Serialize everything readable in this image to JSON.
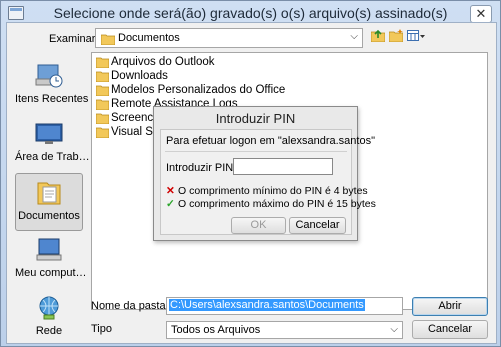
{
  "title": "Selecione onde será(ão) gravado(s) o(s) arquivo(s) assinado(s)",
  "look_in": {
    "label": "Examinar",
    "value": "Documentos"
  },
  "places": [
    {
      "label": "Itens Recentes"
    },
    {
      "label": "Área de Trab…"
    },
    {
      "label": "Documentos"
    },
    {
      "label": "Meu comput…"
    },
    {
      "label": "Rede"
    }
  ],
  "files": [
    {
      "name": "Arquivos do Outlook"
    },
    {
      "name": "Downloads"
    },
    {
      "name": "Modelos Personalizados do Office"
    },
    {
      "name": "Remote Assistance Logs"
    },
    {
      "name": "Screencast"
    },
    {
      "name": "Visual Studio"
    }
  ],
  "file_name": {
    "label": "Nome da pasta:",
    "value": "C:\\Users\\alexsandra.santos\\Documents"
  },
  "file_type": {
    "label": "Tipo",
    "value": "Todos os Arquivos"
  },
  "buttons": {
    "open": "Abrir",
    "cancel": "Cancelar"
  },
  "pin_dialog": {
    "title": "Introduzir PIN",
    "prompt": "Para efetuar logon em \"alexsandra.santos\"",
    "pin_label": "Introduzir PIN:",
    "pin_value": "",
    "rules": [
      {
        "status": "fail",
        "text": "O comprimento mínimo do PIN é 4 bytes"
      },
      {
        "status": "ok",
        "text": "O comprimento máximo do PIN é 15 bytes"
      }
    ],
    "ok": "OK",
    "cancel": "Cancelar"
  },
  "colors": {
    "fail": "#d00000",
    "ok": "#2aa52a",
    "selection": "#3399ff",
    "folder": "#f2c85a"
  }
}
